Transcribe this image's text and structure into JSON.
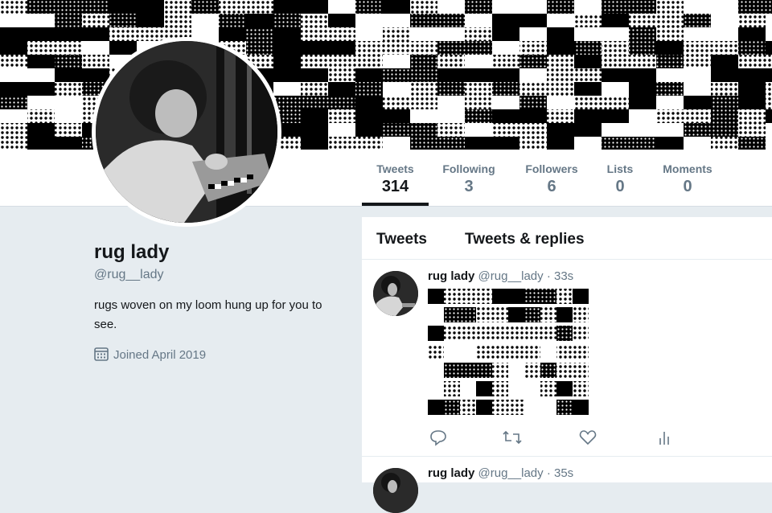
{
  "profile": {
    "name": "rug lady",
    "handle": "@rug__lady",
    "bio": "rugs woven on my loom hung up for you to see.",
    "joined": "Joined April 2019"
  },
  "stats": [
    {
      "label": "Tweets",
      "value": "314"
    },
    {
      "label": "Following",
      "value": "3"
    },
    {
      "label": "Followers",
      "value": "6"
    },
    {
      "label": "Lists",
      "value": "0"
    },
    {
      "label": "Moments",
      "value": "0"
    }
  ],
  "timeline_tabs": [
    "Tweets",
    "Tweets & replies"
  ],
  "tweets": [
    {
      "name": "rug lady",
      "handle": "@rug__lady",
      "dot": "·",
      "time": "33s"
    },
    {
      "name": "rug lady",
      "handle": "@rug__lady",
      "dot": "·",
      "time": "35s"
    }
  ],
  "icons": {
    "reply": "reply-icon",
    "retweet": "retweet-icon",
    "like": "heart-icon",
    "analytics": "analytics-icon",
    "calendar": "calendar-icon"
  },
  "colors": {
    "page_bg": "#e6ecf0",
    "muted_text": "#657786",
    "primary_text": "#14171a",
    "card_bg": "#ffffff"
  }
}
